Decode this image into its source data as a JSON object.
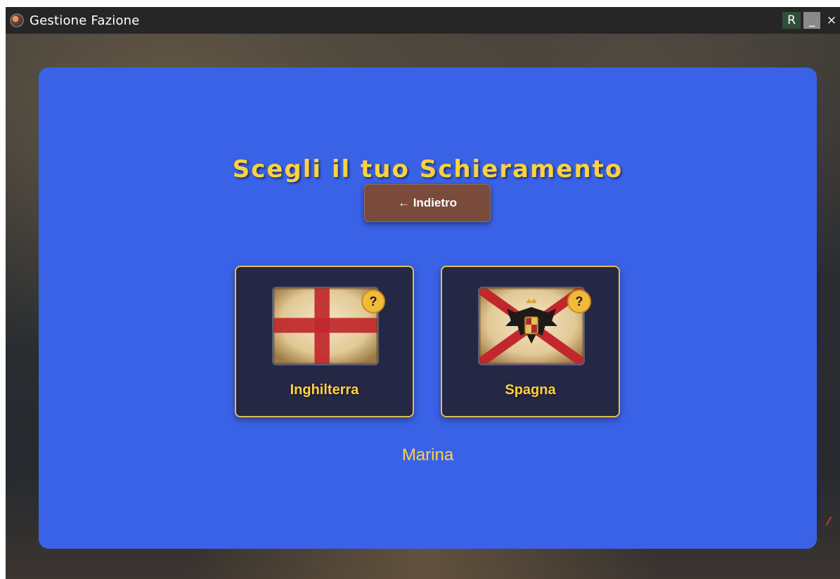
{
  "window": {
    "title": "Gestione Fazione",
    "controls": {
      "r": "R",
      "minimize": "_",
      "close": "×"
    }
  },
  "screen": {
    "heading": "Scegli il tuo Schieramento",
    "back_button": "← Indietro",
    "factions": [
      {
        "name": "Inghilterra",
        "flag": "st-george-cross-flag",
        "help": "?"
      },
      {
        "name": "Spagna",
        "flag": "cross-of-burgundy-eagle-flag",
        "help": "?"
      }
    ],
    "category": "Marina"
  },
  "colors": {
    "panel": "#3a62e6",
    "accent_gold": "#ffd23f",
    "card_bg": "#242845",
    "back_button": "#7a4a3a"
  }
}
